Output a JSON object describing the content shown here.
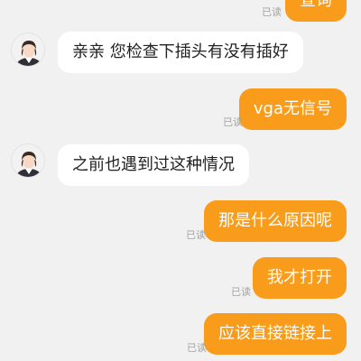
{
  "read_label": "已读",
  "messages": [
    {
      "side": "out",
      "text": "查询",
      "read": true
    },
    {
      "side": "in",
      "text": "亲亲 您检查下插头有没有插好"
    },
    {
      "side": "out",
      "text": "vga无信号",
      "read": true
    },
    {
      "side": "in",
      "text": "之前也遇到过这种情况"
    },
    {
      "side": "out",
      "text": "那是什么原因呢",
      "read": true
    },
    {
      "side": "out",
      "text": "我才打开",
      "read": true
    },
    {
      "side": "out",
      "text": "应该直接链接上",
      "read": true
    }
  ],
  "avatar": {
    "icon": "agent-avatar-icon"
  },
  "colors": {
    "outgoing": "#f99b1b",
    "incoming": "#ffffff",
    "background": "#f1f1f1"
  }
}
